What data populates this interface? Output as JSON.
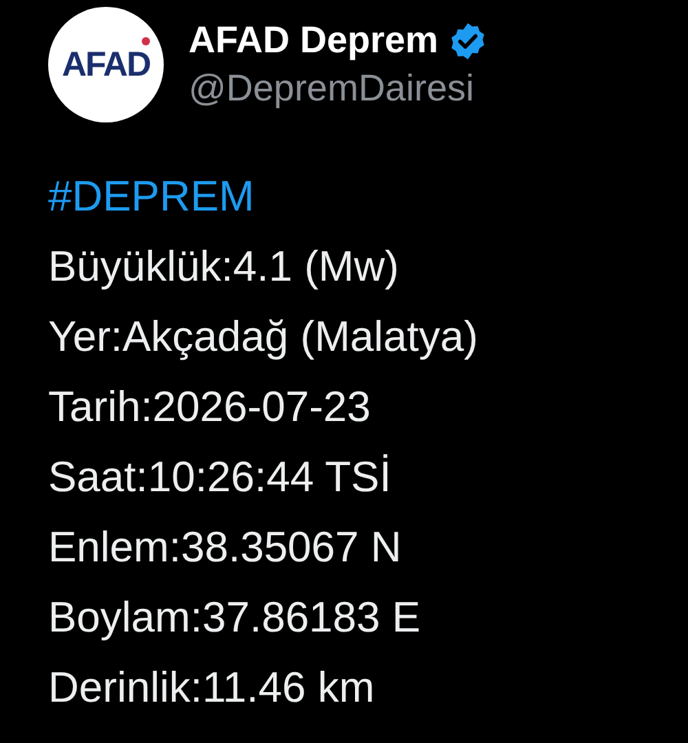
{
  "author": {
    "logo_text": "AFAD",
    "name": "AFAD Deprem",
    "verified": true,
    "handle": "@DepremDairesi"
  },
  "tweet": {
    "hashtag": "#DEPREM",
    "lines": [
      "Büyüklük:4.1 (Mw)",
      "Yer:Akçadağ (Malatya)",
      "Tarih:2026-07-23",
      "Saat:10:26:44 TSİ",
      "Enlem:38.35067 N",
      "Boylam:37.86183 E",
      "Derinlik:11.46 km"
    ]
  }
}
